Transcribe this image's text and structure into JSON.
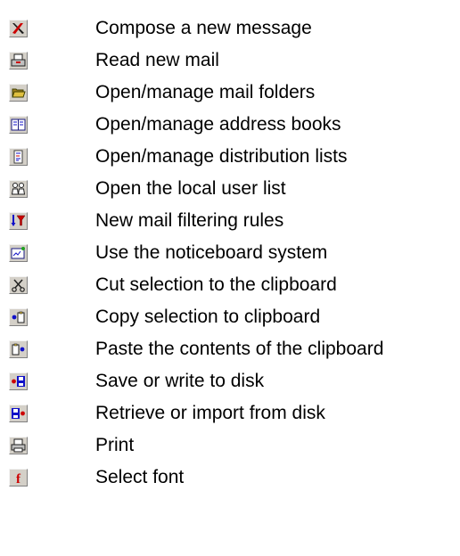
{
  "toolbar_legend": {
    "items": [
      {
        "icon": "compose-icon",
        "label": "Compose a new message"
      },
      {
        "icon": "read-mail-icon",
        "label": "Read new mail"
      },
      {
        "icon": "folder-icon",
        "label": "Open/manage mail folders"
      },
      {
        "icon": "address-book-icon",
        "label": "Open/manage address books"
      },
      {
        "icon": "distribution-list-icon",
        "label": "Open/manage distribution lists"
      },
      {
        "icon": "users-icon",
        "label": "Open the local user list"
      },
      {
        "icon": "filter-rules-icon",
        "label": "New mail filtering rules"
      },
      {
        "icon": "noticeboard-icon",
        "label": "Use the noticeboard system"
      },
      {
        "icon": "cut-icon",
        "label": "Cut selection to the clipboard"
      },
      {
        "icon": "copy-icon",
        "label": "Copy selection to clipboard"
      },
      {
        "icon": "paste-icon",
        "label": "Paste the contents of the clipboard"
      },
      {
        "icon": "save-to-disk-icon",
        "label": "Save or write to disk"
      },
      {
        "icon": "retrieve-from-disk-icon",
        "label": "Retrieve or import from disk"
      },
      {
        "icon": "print-icon",
        "label": "Print"
      },
      {
        "icon": "font-icon",
        "label": "Select font"
      }
    ]
  },
  "colors": {
    "button_face": "#d4d0c8",
    "accent_red": "#cc0000",
    "accent_blue": "#1010c8",
    "accent_yellow": "#e0c040",
    "accent_green": "#20a020"
  }
}
